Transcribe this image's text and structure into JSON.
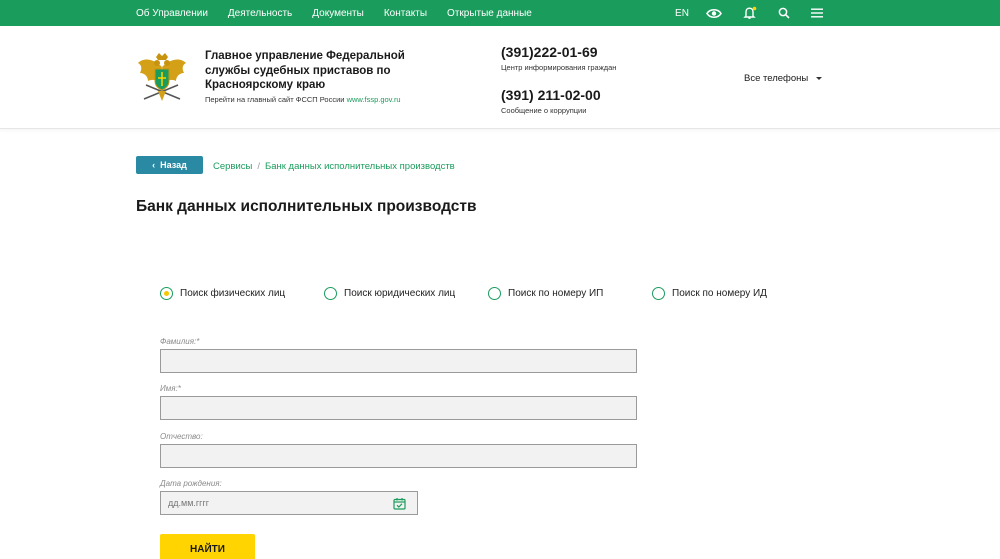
{
  "topnav": {
    "items": [
      "Об Управлении",
      "Деятельность",
      "Документы",
      "Контакты",
      "Открытые данные"
    ],
    "lang": "EN"
  },
  "header": {
    "org_name": "Главное управление Федеральной службы судебных приставов по Красноярскому краю",
    "link_prefix": "Перейти на главный сайт ФССП России",
    "link_url_text": "www.fssp.gov.ru",
    "phone1": "(391)222-01-69",
    "phone1_caption": "Центр информирования граждан",
    "phone2": "(391) 211-02-00",
    "phone2_caption": "Сообщение о коррупции",
    "all_phones": "Все телефоны"
  },
  "breadcrumb": {
    "back": "Назад",
    "items": [
      "Сервисы",
      "Банк данных исполнительных производств"
    ]
  },
  "page_title": "Банк данных исполнительных производств",
  "search_types": [
    {
      "label": "Поиск физических лиц",
      "selected": true
    },
    {
      "label": "Поиск юридических лиц",
      "selected": false
    },
    {
      "label": "Поиск по номеру ИП",
      "selected": false
    },
    {
      "label": "Поиск по номеру ИД",
      "selected": false
    }
  ],
  "form": {
    "last_name_label": "Фамилия:*",
    "first_name_label": "Имя:*",
    "patronymic_label": "Отчество:",
    "birth_date_label": "Дата рождения:",
    "birth_date_placeholder": "дд.мм.гггг",
    "submit": "НАЙТИ"
  },
  "colors": {
    "brand_green": "#1a9c5c",
    "back_button": "#2a8aa4",
    "submit_yellow": "#ffd400"
  },
  "icons": [
    "eye-icon",
    "bell-icon",
    "search-icon",
    "menu-icon",
    "calendar-icon",
    "emblem-logo"
  ]
}
